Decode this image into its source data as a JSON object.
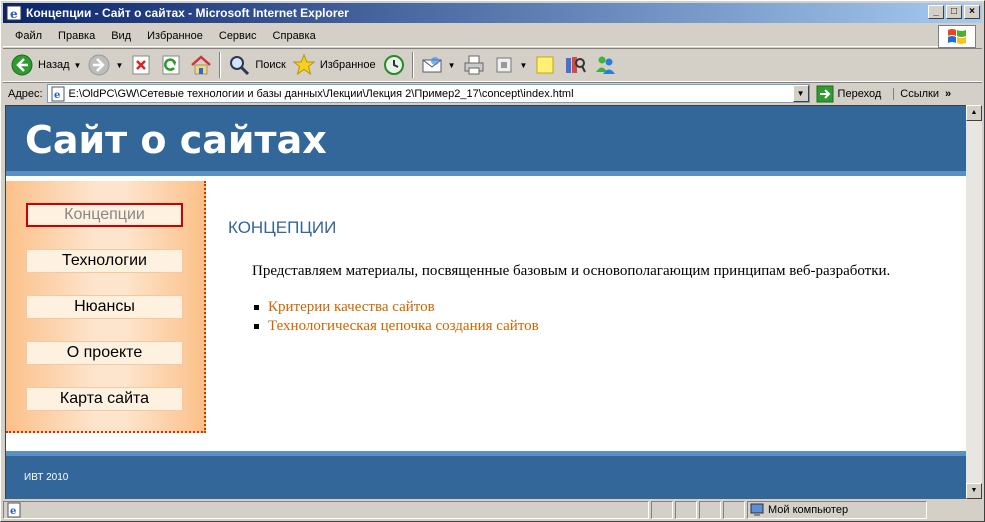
{
  "window": {
    "title": "Концепции - Сайт о сайтах - Microsoft Internet Explorer",
    "min_glyph": "_",
    "max_glyph": "□",
    "close_glyph": "×"
  },
  "menu": [
    "Файл",
    "Правка",
    "Вид",
    "Избранное",
    "Сервис",
    "Справка"
  ],
  "toolbar": {
    "back_label": "Назад",
    "search_label": "Поиск",
    "favorites_label": "Избранное"
  },
  "address": {
    "label": "Адрес:",
    "url": "E:\\OldPC\\GW\\Сетевые технологии и базы данных\\Лекции\\Лекция 2\\Пример2_17\\concept\\index.html",
    "go_label": "Переход",
    "links_label": "Ссылки",
    "links_chevron": "»"
  },
  "site": {
    "title": "Сайт о сайтах",
    "nav": [
      "Концепции",
      "Технологии",
      "Нюансы",
      "О проекте",
      "Карта сайта"
    ],
    "active_nav_index": 0,
    "heading": "КОНЦЕПЦИИ",
    "intro": "Представляем материалы, посвященные базовым и основополагающим принципам веб-разработки.",
    "links": [
      "Критерии качества сайтов",
      "Технологическая цепочка создания сайтов"
    ],
    "footer": "ИВТ 2010"
  },
  "status": {
    "zone": "Мой компьютер"
  },
  "colors": {
    "header_bg": "#336699",
    "link": "#cc6600",
    "active_nav_border": "#cc0000"
  }
}
